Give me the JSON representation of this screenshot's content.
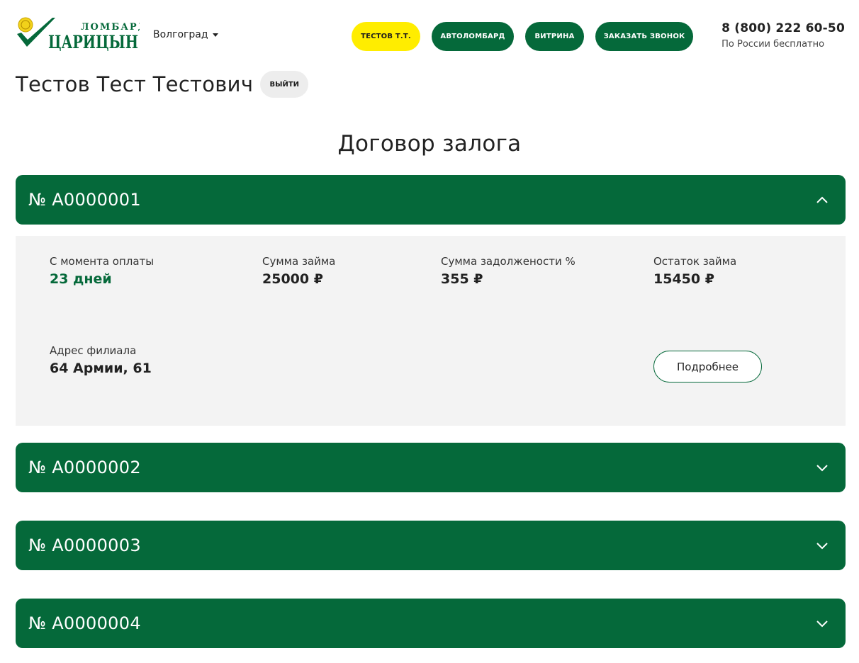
{
  "header": {
    "logo_icon": "checkmark-coin-logo",
    "logo_top": "ЛОМБАРД",
    "logo_main": "ЦАРИЦЫН",
    "city": "Волгоград",
    "user_short": "ТЕСТОВ Т.Т.",
    "nav": {
      "auto": "АВТОЛОМБАРД",
      "vitrina": "ВИТРИНА",
      "call": "ЗАКАЗАТЬ ЗВОНОК"
    },
    "phone": "8 (800) 222 60-50",
    "phone_sub": "По России бесплатно"
  },
  "user": {
    "name": "Тестов Тест Тестович",
    "logout": "ВЫЙТИ"
  },
  "page_title": "Договор залога",
  "contracts": [
    {
      "number": "№ А0000001",
      "expanded": true,
      "since_payment_label": "С момента оплаты",
      "since_payment_value": "23 дней",
      "loan_label": "Сумма займа",
      "loan_value": "25000 ₽",
      "debt_label": "Сумма задолжености %",
      "debt_value": "355 ₽",
      "remain_label": "Остаток займа",
      "remain_value": "15450 ₽",
      "branch_label": "Адрес филиала",
      "branch_value": "64 Армии, 61",
      "details_button": "Подробнее"
    },
    {
      "number": "№ А0000002",
      "expanded": false
    },
    {
      "number": "№ А0000003",
      "expanded": false
    },
    {
      "number": "№ А0000004",
      "expanded": false
    }
  ],
  "colors": {
    "brand_green": "#05693a",
    "accent_yellow": "#ffed00",
    "panel_gray": "#f3f3f3"
  }
}
